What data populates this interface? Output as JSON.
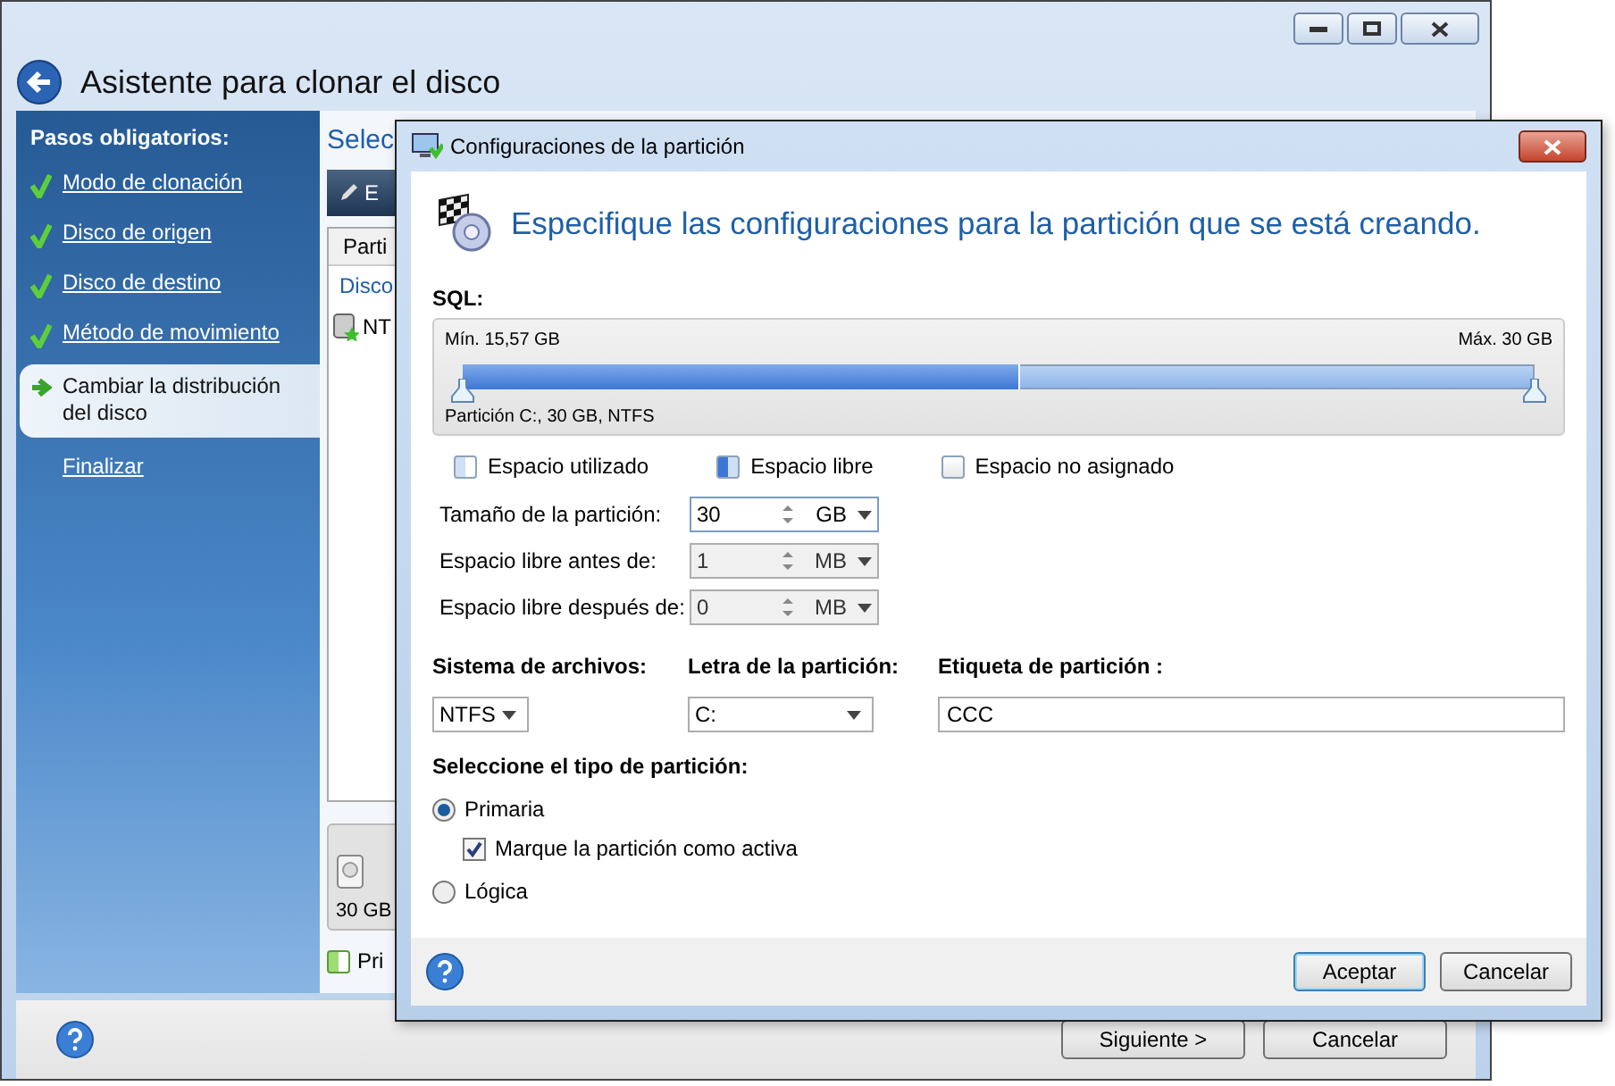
{
  "window": {
    "title": "Asistente para clonar el disco"
  },
  "sidebar": {
    "heading": "Pasos obligatorios:",
    "items": [
      {
        "label": "Modo de clonación",
        "done": true,
        "selected": false
      },
      {
        "label": "Disco de origen",
        "done": true,
        "selected": false
      },
      {
        "label": "Disco de destino",
        "done": true,
        "selected": false
      },
      {
        "label": "Método de movimiento",
        "done": true,
        "selected": false
      },
      {
        "label": "Cambiar la distribución del disco",
        "done": false,
        "selected": true
      },
      {
        "label": "Finalizar",
        "done": false,
        "selected": false
      }
    ]
  },
  "main": {
    "heading": "Selec",
    "toolbar_button": "E",
    "column_header": "Parti",
    "group_label": "Disco",
    "row_label": "NT",
    "disk_size": "30 GB",
    "legend_label": "Pri"
  },
  "footer": {
    "buttons": [
      {
        "label": "Siguiente >"
      },
      {
        "label": "Cancelar"
      }
    ]
  },
  "dialog": {
    "title": "Configuraciones de la partición",
    "heading": "Especifique las configuraciones para la partición que se está creando.",
    "disk_label": "SQL:",
    "bar": {
      "min_label": "Mín. 15,57 GB",
      "max_label": "Máx. 30 GB",
      "partition_label": "Partición C:, 30 GB, NTFS",
      "used": {
        "level": 0.52
      },
      "partition": {
        "level": 1
      }
    },
    "legend": [
      {
        "label": "Espacio utilizado",
        "kind": "used"
      },
      {
        "label": "Espacio libre",
        "kind": "free"
      },
      {
        "label": "Espacio no asignado",
        "kind": "unallocated"
      }
    ],
    "sizes": [
      {
        "label": "Tamaño de la partición:",
        "value": "30",
        "unit": "GB",
        "disabled": false
      },
      {
        "label": "Espacio libre antes de:",
        "value": "1",
        "unit": "MB",
        "disabled": true
      },
      {
        "label": "Espacio libre después de:",
        "value": "0",
        "unit": "MB",
        "disabled": true
      }
    ],
    "file_system": {
      "label": "Sistema de archivos:",
      "value": "NTFS"
    },
    "letter": {
      "label": "Letra de la partición:",
      "value": "C:"
    },
    "partition_label": {
      "label": "Etiqueta de partición :",
      "value": "CCC"
    },
    "type_heading": "Seleccione el tipo de partición:",
    "types": [
      {
        "label": "Primaria",
        "selected": true,
        "checkbox": {
          "label": "Marque la partición como activa",
          "checked": true
        }
      },
      {
        "label": "Lógica",
        "selected": false
      }
    ],
    "buttons": [
      {
        "label": "Aceptar",
        "default": true
      },
      {
        "label": "Cancelar",
        "default": false
      }
    ]
  }
}
